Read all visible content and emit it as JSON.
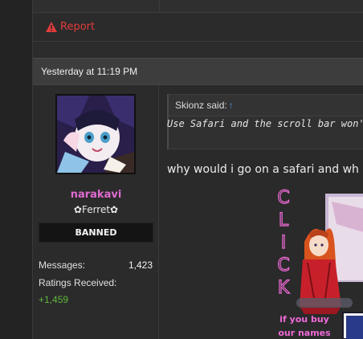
{
  "previous_post": {
    "report_label": "Report"
  },
  "post": {
    "date": "Yesterday at 11:19 PM",
    "user": {
      "name": "narakavi",
      "title": "✿Ferret✿",
      "banner": "BANNED",
      "stats": {
        "messages_label": "Messages:",
        "messages_value": "1,423",
        "ratings_label": "Ratings Received:",
        "ratings_value": "+1,459"
      }
    },
    "quote": {
      "author": "Skionz said:",
      "arrow": "↑",
      "text": "Use Safari and the scroll bar won't"
    },
    "message": "why would i go on a safari and wh",
    "signature_banner": {
      "letters": [
        "C",
        "L",
        "I",
        "C",
        "K"
      ],
      "caption_line1": "if you buy",
      "caption_line2": "our names"
    }
  },
  "colors": {
    "report": "#e23b3b",
    "username": "#e06ad0",
    "ratings": "#5fb83a",
    "quote_arrow": "#4e8fd6",
    "banner_text": "#f06ad8"
  }
}
